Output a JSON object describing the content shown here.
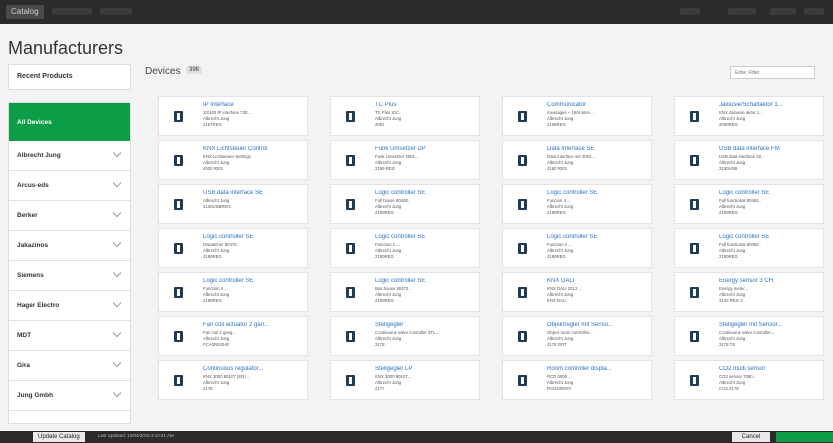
{
  "app": {
    "tab_label": "Catalog"
  },
  "sidebar": {
    "title": "Manufacturers",
    "recent_label": "Recent Products",
    "items": [
      {
        "label": "All Devices",
        "active": true
      },
      {
        "label": "Albrecht Jung"
      },
      {
        "label": "Arcus-eds"
      },
      {
        "label": "Berker"
      },
      {
        "label": "Jakazinos"
      },
      {
        "label": "Siemens"
      },
      {
        "label": "Hager Electro"
      },
      {
        "label": "MDT"
      },
      {
        "label": "Gira"
      },
      {
        "label": "Jung Gmbh"
      }
    ]
  },
  "main": {
    "title": "Devices",
    "count": "398",
    "search_placeholder": "Enter Filter",
    "devices": [
      {
        "name": "IP Interface",
        "lines": [
          "10/100 IP interface 730...",
          "Albrecht Jung",
          "2167REG"
        ]
      },
      {
        "name": "TC Plus",
        "lines": [
          "TC Plus IGC..",
          "Albrecht Jung",
          "2001"
        ]
      },
      {
        "name": "Communicator",
        "lines": [
          "messages + 16/8 sites ...",
          "Albrecht Jung",
          "2168REG"
        ]
      },
      {
        "name": "Jalousie/Schaltaktor 1...",
        "lines": [
          "KNX Jalousie aktor 1...",
          "Albrecht Jung",
          "2060REG"
        ]
      },
      {
        "name": "KNX Lichtsteuer Control",
        "lines": [
          "KNX Lichtsteuer Settings",
          "Albrecht Jung",
          "4000 REG"
        ]
      },
      {
        "name": "Funk Umsetzer DP",
        "lines": [
          "Funk Umsetzer 2001...",
          "Albrecht Jung",
          "2159 REG"
        ]
      },
      {
        "name": "Data Interface SE",
        "lines": [
          "Data interface set 2002...",
          "Albrecht Jung",
          "2160 REG"
        ]
      },
      {
        "name": "USB data interface FM",
        "lines": [
          "USB data interface 20...",
          "Albrecht Jung",
          "2130USB"
        ]
      },
      {
        "name": "USB data interface SE",
        "lines": [
          "Albrecht Jung",
          "2130USBREG"
        ]
      },
      {
        "name": "Logic controller SE",
        "lines": [
          "Full house 80482..",
          "Albrecht Jung",
          "2190REG"
        ]
      },
      {
        "name": "Logic controller SE",
        "lines": [
          "Funcion 4 ...",
          "Albrecht Jung",
          "2190REG"
        ]
      },
      {
        "name": "Logic controller SE",
        "lines": [
          "Full functional 80482..",
          "Albrecht Jung",
          "2190REG"
        ]
      },
      {
        "name": "Logic controller SE",
        "lines": [
          "Dispatcher 80470..",
          "Albrecht Jung",
          "2190REG"
        ]
      },
      {
        "name": "Logic controller SE",
        "lines": [
          "Function 1 ...",
          "Albrecht Jung",
          "2190REG"
        ]
      },
      {
        "name": "Logic controller SE",
        "lines": [
          "Function 4 ...",
          "Albrecht Jung",
          "2190REG"
        ]
      },
      {
        "name": "Logic controller SE",
        "lines": [
          "Full functional 80482..",
          "Albrecht Jung",
          "2190REG"
        ]
      },
      {
        "name": "Logic controller SE",
        "lines": [
          "Function 4 ...",
          "Albrecht Jung",
          "2190REG"
        ]
      },
      {
        "name": "Logic controller SE",
        "lines": [
          "Bus house 80472..",
          "Albrecht Jung",
          "2190REG"
        ]
      },
      {
        "name": "KNX DALI",
        "lines": [
          "KNX DALI 2012...",
          "Albrecht Jung",
          "KNX DALI"
        ]
      },
      {
        "name": "Energy sensor 3 CH",
        "lines": [
          "Energy meter...",
          "Albrecht Jung",
          "3140 REG 3"
        ]
      },
      {
        "name": "Fan coil actuator 2 gan...",
        "lines": [
          "Fan coil 2 gang...",
          "Albrecht Jung",
          "FCA2REGHE"
        ]
      },
      {
        "name": "Stellgegler",
        "lines": [
          "Continuous valve controller 3TL...",
          "Albrecht Jung",
          "2178"
        ]
      },
      {
        "name": "Objektregler mit Senso...",
        "lines": [
          "Object room controller...",
          "Albrecht Jung",
          "2178 GRT"
        ]
      },
      {
        "name": "Stellgegler mit Sensor...",
        "lines": [
          "Continuous valve controller...",
          "Albrecht Jung",
          "2178 TS"
        ]
      },
      {
        "name": "Continuous regulator...",
        "lines": [
          "KNX 3000 80107 (EN) ...",
          "Albrecht Jung",
          "2178"
        ]
      },
      {
        "name": "Stellgegler LP",
        "lines": [
          "KNX 3000 80107...",
          "Albrecht Jung",
          "2177"
        ]
      },
      {
        "name": "Room controller displa...",
        "lines": [
          "RCD 3000 ...",
          "Albrecht Jung",
          "RCD4092ST"
        ]
      },
      {
        "name": "CO2 multi sensor",
        "lines": [
          "CO2 sensor 7080...",
          "Albrecht Jung",
          "CO2 2178"
        ]
      }
    ]
  },
  "footer": {
    "update_label": "Update Catalog",
    "last_updated": "Last Updated: 12/04/2016 3:10:41 AM",
    "cancel_label": "Cancel"
  },
  "colors": {
    "accent": "#0e9d47",
    "link": "#2a73c0",
    "bar": "#2b2b2b"
  }
}
